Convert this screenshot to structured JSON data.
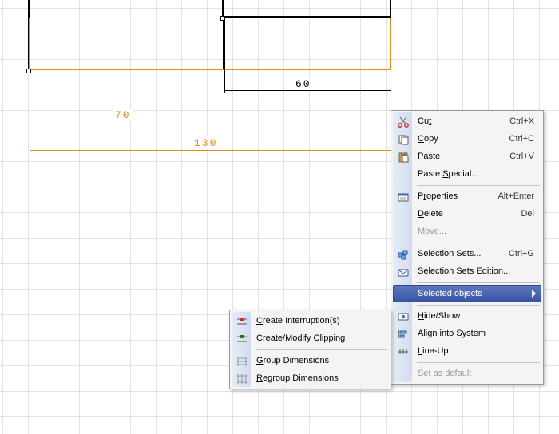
{
  "dimensions": {
    "d60": "60",
    "d70": "70",
    "d130": "130"
  },
  "main_menu": {
    "cut": {
      "label": "Cut",
      "ul": "t",
      "shortcut": "Ctrl+X"
    },
    "copy": {
      "label": "Copy",
      "ul": "C",
      "shortcut": "Ctrl+C"
    },
    "paste": {
      "label": "Paste",
      "ul": "P",
      "shortcut": "Ctrl+V"
    },
    "paste_special": {
      "label": "Paste Special...",
      "ul": "S"
    },
    "properties": {
      "label": "Properties",
      "ul": "r",
      "shortcut": "Alt+Enter"
    },
    "delete": {
      "label": "Delete",
      "ul": "D",
      "shortcut": "Del"
    },
    "move": {
      "label": "Move...",
      "ul": "M"
    },
    "selection_sets": {
      "label": "Selection Sets...",
      "ul": "",
      "shortcut": "Ctrl+G"
    },
    "selection_sets_edition": {
      "label": "Selection Sets Edition...",
      "ul": ""
    },
    "selected_objects": {
      "label": "Selected objects"
    },
    "hide_show": {
      "label": "Hide/Show",
      "ul": "H"
    },
    "align_into_system": {
      "label": "Align into System",
      "ul": "A"
    },
    "line_up": {
      "label": "Line-Up",
      "ul": "L"
    },
    "set_as_default": {
      "label": "Set as default"
    }
  },
  "sub_menu": {
    "create_interruption": {
      "label": "Create Interruption(s)",
      "ul": "C"
    },
    "create_modify_clipping": {
      "label": "Create/Modify Clipping",
      "ul": ""
    },
    "group_dimensions": {
      "label": "Group Dimensions",
      "ul": "G"
    },
    "regroup_dimensions": {
      "label": "Regroup Dimensions",
      "ul": "R"
    }
  },
  "chart_data": null
}
